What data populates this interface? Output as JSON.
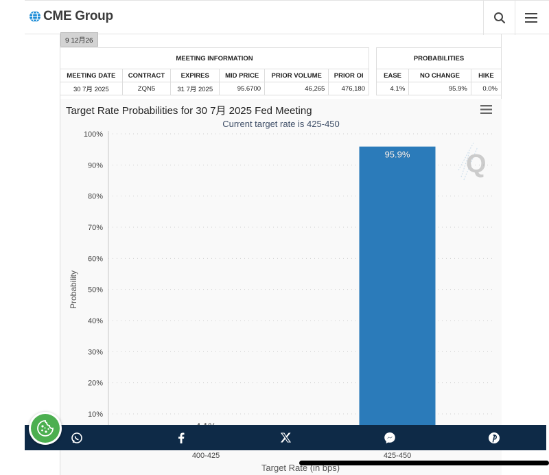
{
  "header": {
    "brand": "CME Group",
    "icons": {
      "logo": "globe-icon",
      "search": "search-icon",
      "menu": "hamburger-menu-icon"
    }
  },
  "date_chip": "9 12月26",
  "meeting_info": {
    "title": "MEETING INFORMATION",
    "columns": [
      "MEETING DATE",
      "CONTRACT",
      "EXPIRES",
      "MID PRICE",
      "PRIOR VOLUME",
      "PRIOR OI"
    ],
    "row": [
      "30 7月 2025",
      "ZQN5",
      "31 7月 2025",
      "95.6700",
      "46,265",
      "476,180"
    ]
  },
  "probabilities": {
    "title": "PROBABILITIES",
    "columns": [
      "EASE",
      "NO CHANGE",
      "HIKE"
    ],
    "row": [
      "4.1%",
      "95.9%",
      "0.0%"
    ]
  },
  "chart_menu_icon": "hamburger-menu-icon",
  "watermark_icon": "quikstrike-q-logo-icon",
  "chart_data": {
    "type": "bar",
    "title": "Target Rate Probabilities for 30 7月 2025 Fed Meeting",
    "subtitle": "Current target rate is 425-450",
    "categories": [
      "400-425",
      "425-450"
    ],
    "values": [
      4.1,
      95.9
    ],
    "data_labels": [
      "4.1%",
      "95.9%"
    ],
    "xlabel": "Target Rate (in bps)",
    "ylabel": "Probability",
    "ylim": [
      0,
      100
    ],
    "yticks": [
      "100%",
      "90%",
      "80%",
      "70%",
      "60%",
      "50%",
      "40%",
      "30%",
      "20%",
      "10%"
    ],
    "ytick_values": [
      100,
      90,
      80,
      70,
      60,
      50,
      40,
      30,
      20,
      10
    ],
    "grid": true,
    "bar_color": "#2b7bba"
  },
  "share_bar": {
    "icons": [
      "whatsapp-icon",
      "facebook-icon",
      "x-twitter-icon",
      "messenger-icon",
      "pinterest-icon"
    ],
    "background": "#0e2a47"
  },
  "cookie_button": {
    "icon": "cookie-icon",
    "color": "#4caf50"
  }
}
